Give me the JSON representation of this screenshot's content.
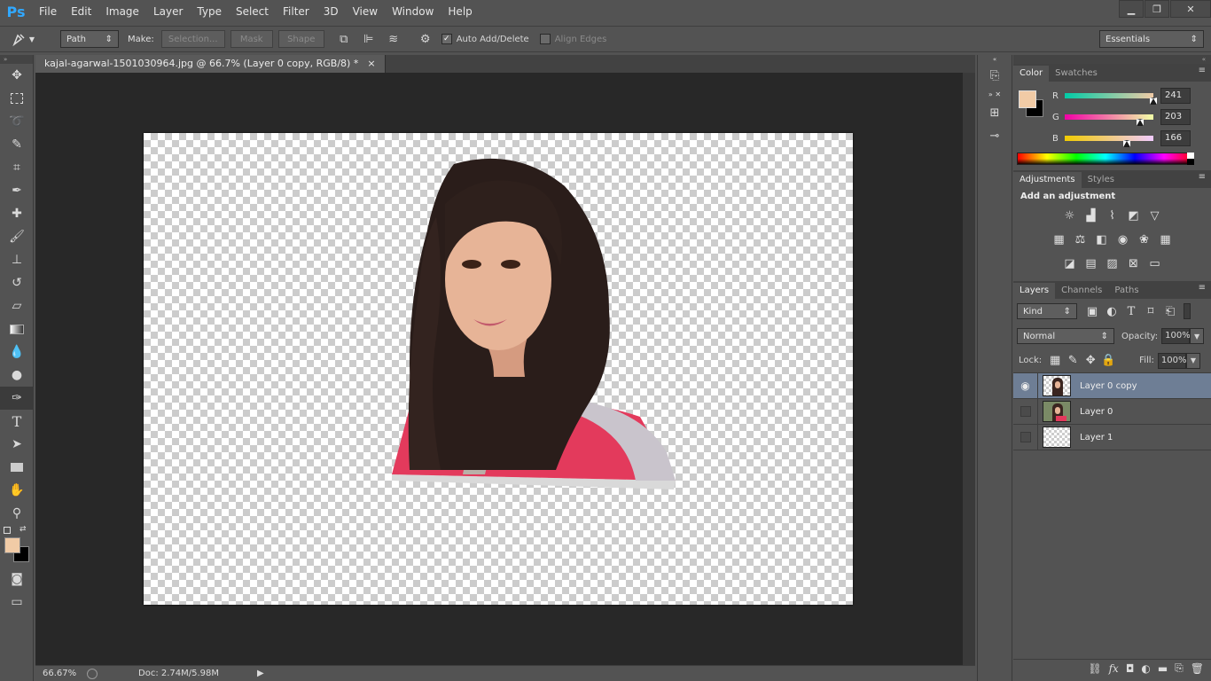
{
  "app": {
    "logo": "Ps"
  },
  "menu": [
    "File",
    "Edit",
    "Image",
    "Layer",
    "Type",
    "Select",
    "Filter",
    "3D",
    "View",
    "Window",
    "Help"
  ],
  "window_controls": {
    "minimize": "▁",
    "restore": "❐",
    "close": "✕"
  },
  "options": {
    "mode": "Path",
    "make_label": "Make:",
    "selection_btn": "Selection...",
    "mask_btn": "Mask",
    "shape_btn": "Shape",
    "auto_add_delete": "Auto Add/Delete",
    "auto_add_delete_checked": true,
    "align_edges": "Align Edges",
    "align_edges_checked": false,
    "workspace": "Essentials"
  },
  "document": {
    "tab_title": "kajal-agarwal-1501030964.jpg @ 66.7% (Layer 0 copy, RGB/8) *",
    "tab_close": "×"
  },
  "status": {
    "zoom": "66.67%",
    "doc": "Doc: 2.74M/5.98M"
  },
  "color_panel": {
    "tabs": [
      "Color",
      "Swatches"
    ],
    "foreground": "#f1cba6",
    "background": "#000000",
    "channels": [
      {
        "label": "R",
        "value": "241",
        "fraction": 0.945
      },
      {
        "label": "G",
        "value": "203",
        "fraction": 0.796
      },
      {
        "label": "B",
        "value": "166",
        "fraction": 0.651
      }
    ]
  },
  "adjustments_panel": {
    "tabs": [
      "Adjustments",
      "Styles"
    ],
    "heading": "Add an adjustment"
  },
  "layers_panel": {
    "tabs": [
      "Layers",
      "Channels",
      "Paths"
    ],
    "kind_label": "Kind",
    "blend_mode": "Normal",
    "opacity_label": "Opacity:",
    "opacity_value": "100%",
    "lock_label": "Lock:",
    "fill_label": "Fill:",
    "fill_value": "100%",
    "layers": [
      {
        "name": "Layer 0 copy",
        "visible": true,
        "selected": true
      },
      {
        "name": "Layer 0",
        "visible": false,
        "selected": false
      },
      {
        "name": "Layer 1",
        "visible": false,
        "selected": false
      }
    ]
  }
}
